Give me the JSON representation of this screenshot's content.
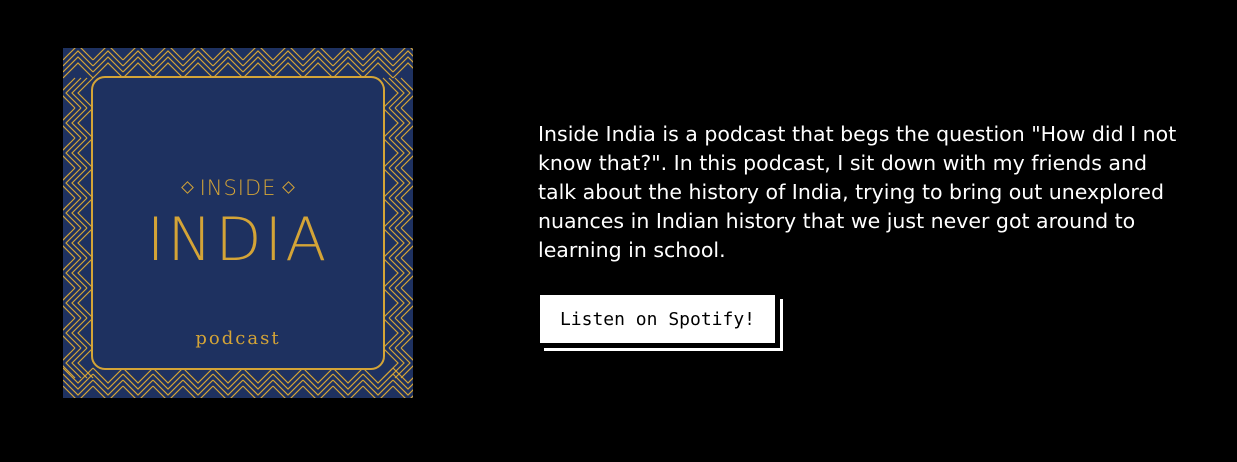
{
  "cover": {
    "kicker": "INSIDE",
    "title": "INDIA",
    "subtitle": "podcast",
    "colors": {
      "background": "#1e3160",
      "gold": "#d4a437"
    }
  },
  "description": "Inside India is a podcast that begs the question \"How did I not know that?\". In this podcast, I sit down with my friends and talk about the history of India, trying to bring out unexplored nuances in Indian history that we just never got around to learning in school.",
  "cta": {
    "label": "Listen on Spotify!"
  },
  "colors": {
    "page_background": "#000000",
    "text": "#ffffff"
  }
}
